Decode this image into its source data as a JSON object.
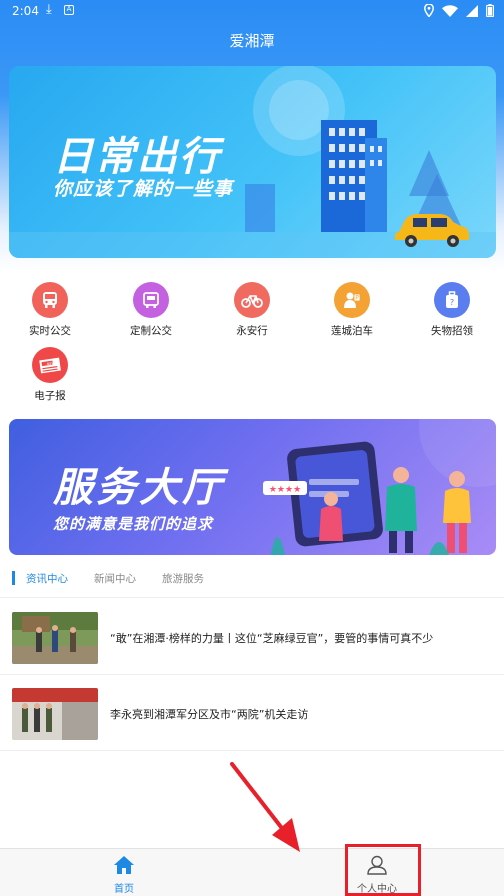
{
  "status_bar": {
    "time": "2:04"
  },
  "app_title": "爱湘潭",
  "banner_top": {
    "title": "日常出行",
    "subtitle": "你应该了解的一些事"
  },
  "menu": [
    {
      "label": "实时公交",
      "icon": "bus-icon",
      "color": "#f0625a"
    },
    {
      "label": "定制公交",
      "icon": "custom-bus-icon",
      "color": "#c461e0"
    },
    {
      "label": "永安行",
      "icon": "bicycle-icon",
      "color": "#f06a60"
    },
    {
      "label": "莲城泊车",
      "icon": "parking-icon",
      "color": "#f3a233"
    },
    {
      "label": "失物招领",
      "icon": "lost-found-icon",
      "color": "#5a7ef0"
    },
    {
      "label": "电子报",
      "icon": "newspaper-icon",
      "color": "#f04848"
    }
  ],
  "banner_service": {
    "title": "服务大厅",
    "subtitle": "您的满意是我们的追求"
  },
  "info_tabs": [
    {
      "label": "资讯中心",
      "active": true
    },
    {
      "label": "新闻中心",
      "active": false
    },
    {
      "label": "旅游服务",
      "active": false
    }
  ],
  "news": [
    {
      "title": "“敢”在湘潭·榜样的力量丨这位“芝麻绿豆官”，要管的事情可真不少"
    },
    {
      "title": "李永亮到湘潭军分区及市“两院”机关走访"
    }
  ],
  "bottom_nav": [
    {
      "label": "首页",
      "icon": "home-icon",
      "active": true
    },
    {
      "label": "个人中心",
      "icon": "user-icon",
      "active": false
    }
  ],
  "colors": {
    "primary": "#1e88e5",
    "annotation": "#e8202a"
  }
}
